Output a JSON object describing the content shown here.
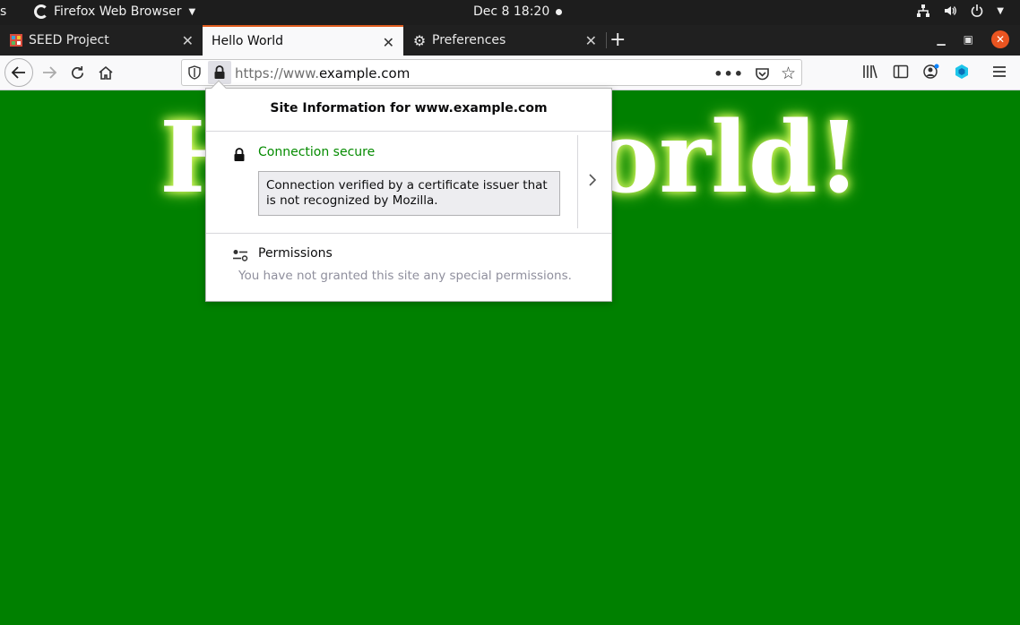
{
  "topbar": {
    "activities": "s",
    "app_name": "Firefox Web Browser",
    "clock": "Dec 8  18:20",
    "tray_icons": [
      "network-icon",
      "volume-icon",
      "power-icon",
      "chevron-down-icon"
    ]
  },
  "tabs": [
    {
      "label": "SEED Project",
      "icon": "seed-favicon",
      "active": false
    },
    {
      "label": "Hello World",
      "icon": "none",
      "active": true
    },
    {
      "label": "Preferences",
      "icon": "gear-icon",
      "active": false
    }
  ],
  "navbar": {
    "url_prefix": "https://www.",
    "url_domain": "example.com"
  },
  "page": {
    "heading": "Hello World!"
  },
  "site_info": {
    "title": "Site Information for www.example.com",
    "connection_status": "Connection secure",
    "connection_note": "Connection verified by a certificate issuer that is not recognized by Mozilla.",
    "permissions_title": "Permissions",
    "permissions_desc": "You have not granted this site any special permissions."
  },
  "colors": {
    "page_bg": "#008000",
    "secure_green": "#058b00",
    "tab_accent": "#e05d1f"
  }
}
